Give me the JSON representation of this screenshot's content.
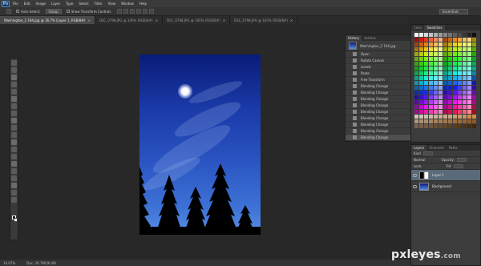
{
  "app": {
    "logo": "Ps"
  },
  "menubar": {
    "items": [
      "File",
      "Edit",
      "Image",
      "Layer",
      "Type",
      "Select",
      "Filter",
      "View",
      "Window",
      "Help"
    ]
  },
  "options": {
    "auto_select_label": "Auto-Select:",
    "auto_select_value": "Group",
    "show_transform_label": "Show Transform Controls",
    "workspace": "Essentials"
  },
  "doc_tabs": [
    {
      "label": "Washington_2 194.jpg @ 16.7% (Layer 1, RGB/8#)",
      "active": true
    },
    {
      "label": "DSC_0798.JPG @ 100% (RGB/8#)",
      "active": false
    },
    {
      "label": "DSC_0798.JPG @ 100% (RGB/8#)",
      "active": false
    },
    {
      "label": "DSC_0798.JPG @ 100% (RGB/8#)",
      "active": false
    }
  ],
  "history": {
    "tabs": [
      "History",
      "Actions"
    ],
    "snapshot": "Washington_2 194.jpg",
    "items": [
      "Open",
      "Rotate Canvas",
      "Levels",
      "Paste",
      "Free Transform",
      "Blending Change",
      "Blending Change",
      "Blending Change",
      "Blending Change",
      "Blending Change",
      "Blending Change",
      "Blending Change",
      "Blending Change",
      "Blending Change"
    ]
  },
  "swatches": {
    "tabs": [
      "Color",
      "Swatches"
    ]
  },
  "layers": {
    "tabs": [
      "Layers",
      "Channels",
      "Paths"
    ],
    "kind_label": "Kind",
    "mode": "Normal",
    "opacity_label": "Opacity:",
    "lock_label": "Lock:",
    "fill_label": "Fill:",
    "items": [
      {
        "name": "Layer 1",
        "selected": true,
        "italic": false
      },
      {
        "name": "Background",
        "selected": false,
        "italic": true
      }
    ]
  },
  "status": {
    "zoom": "16.67%",
    "doc": "Doc: 26.7M/26.4M"
  },
  "watermark": {
    "brand": "pxleyes",
    "tld": ".com"
  },
  "colors": {
    "accent": "#4f86c0",
    "ui_bg": "#282828",
    "sky_top": "#0a1c78",
    "sky_bottom": "#5a8ee4"
  }
}
